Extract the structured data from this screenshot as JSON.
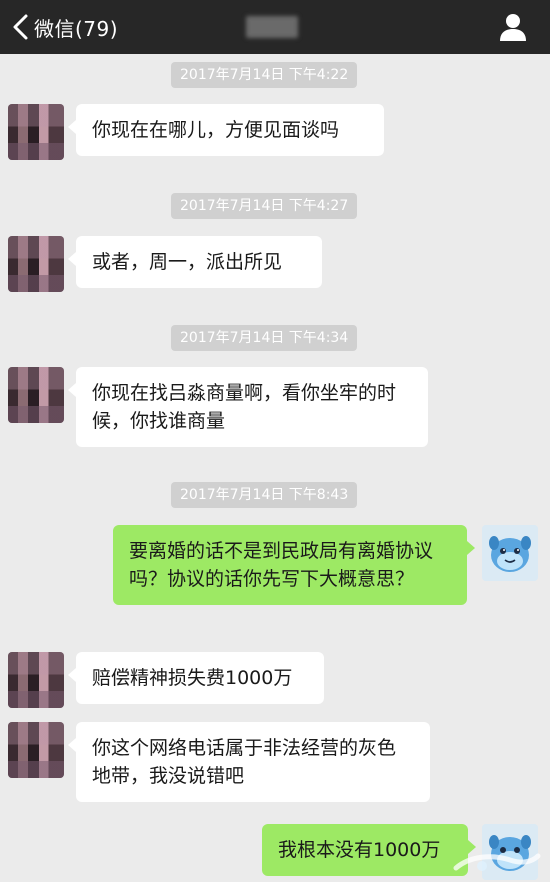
{
  "header": {
    "back_label": "微信(79)",
    "colors": {
      "bar": "#272727",
      "text": "#ffffff"
    }
  },
  "messages": [
    {
      "timestamp": "2017年7月14日 下午4:22",
      "from": "contact",
      "text": "你现在在哪儿，方便见面谈吗"
    },
    {
      "timestamp": "2017年7月14日 下午4:27",
      "from": "contact",
      "text": "或者，周一，派出所见"
    },
    {
      "timestamp": "2017年7月14日 下午4:34",
      "from": "contact",
      "text": "你现在找吕淼商量啊，看你坐牢的时候，你找谁商量"
    },
    {
      "timestamp": "2017年7月14日 下午8:43",
      "from": "me",
      "text": "要离婚的话不是到民政局有离婚协议吗？协议的话你先写下大概意思？"
    },
    {
      "from": "contact",
      "text": "赔偿精神损失费1000万"
    },
    {
      "from": "contact",
      "text": "你这个网络电话属于非法经营的灰色地带，我没说错吧"
    },
    {
      "from": "me",
      "text": "我根本没有1000万"
    }
  ],
  "colors": {
    "background": "#ebebeb",
    "incoming_bubble": "#ffffff",
    "outgoing_bubble": "#9de964",
    "timestamp_pill": "#d0d0d0"
  },
  "icons": {
    "back": "chevron-left-icon",
    "profile": "person-icon",
    "my_avatar": "blue-cartoon-character"
  }
}
